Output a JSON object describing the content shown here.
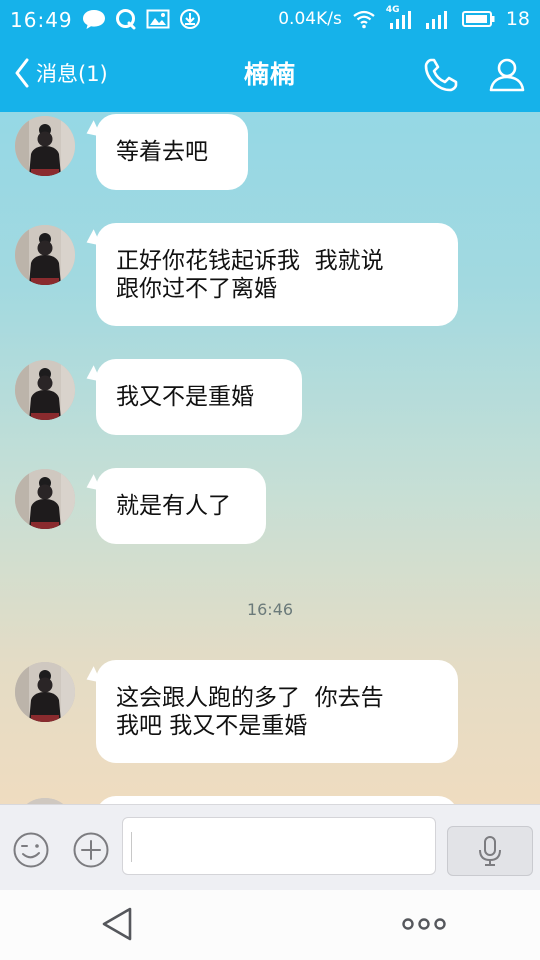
{
  "status_bar": {
    "time": "16:49",
    "network_speed": "0.04K/s",
    "network_type": "4G",
    "battery_level": "18",
    "icons": [
      "chat-bubble-icon",
      "q-notification-icon",
      "image-icon",
      "download-icon",
      "wifi-icon",
      "signal-icon",
      "signal-icon",
      "battery-icon"
    ]
  },
  "header": {
    "back_label": "消息(1)",
    "title": "楠楠",
    "icons": [
      "back-chevron-icon",
      "phone-icon",
      "profile-icon"
    ]
  },
  "messages": [
    {
      "text": "等着去吧"
    },
    {
      "text": "正好你花钱起诉我  我就说\n跟你过不了离婚"
    },
    {
      "text": "我又不是重婚"
    },
    {
      "text": "就是有人了"
    },
    {
      "text": "这会跟人跑的多了  你去告\n我吧 我又不是重婚"
    }
  ],
  "time_divider": "16:46",
  "input_bar": {
    "text_value": "",
    "icons": [
      "emoji-icon",
      "plus-icon",
      "microphone-icon"
    ]
  },
  "system_nav": {
    "icons": [
      "triangle-back-icon",
      "more-dots-icon"
    ]
  },
  "colors": {
    "header_blue": "#16b2ea",
    "bubble_white": "#ffffff"
  }
}
